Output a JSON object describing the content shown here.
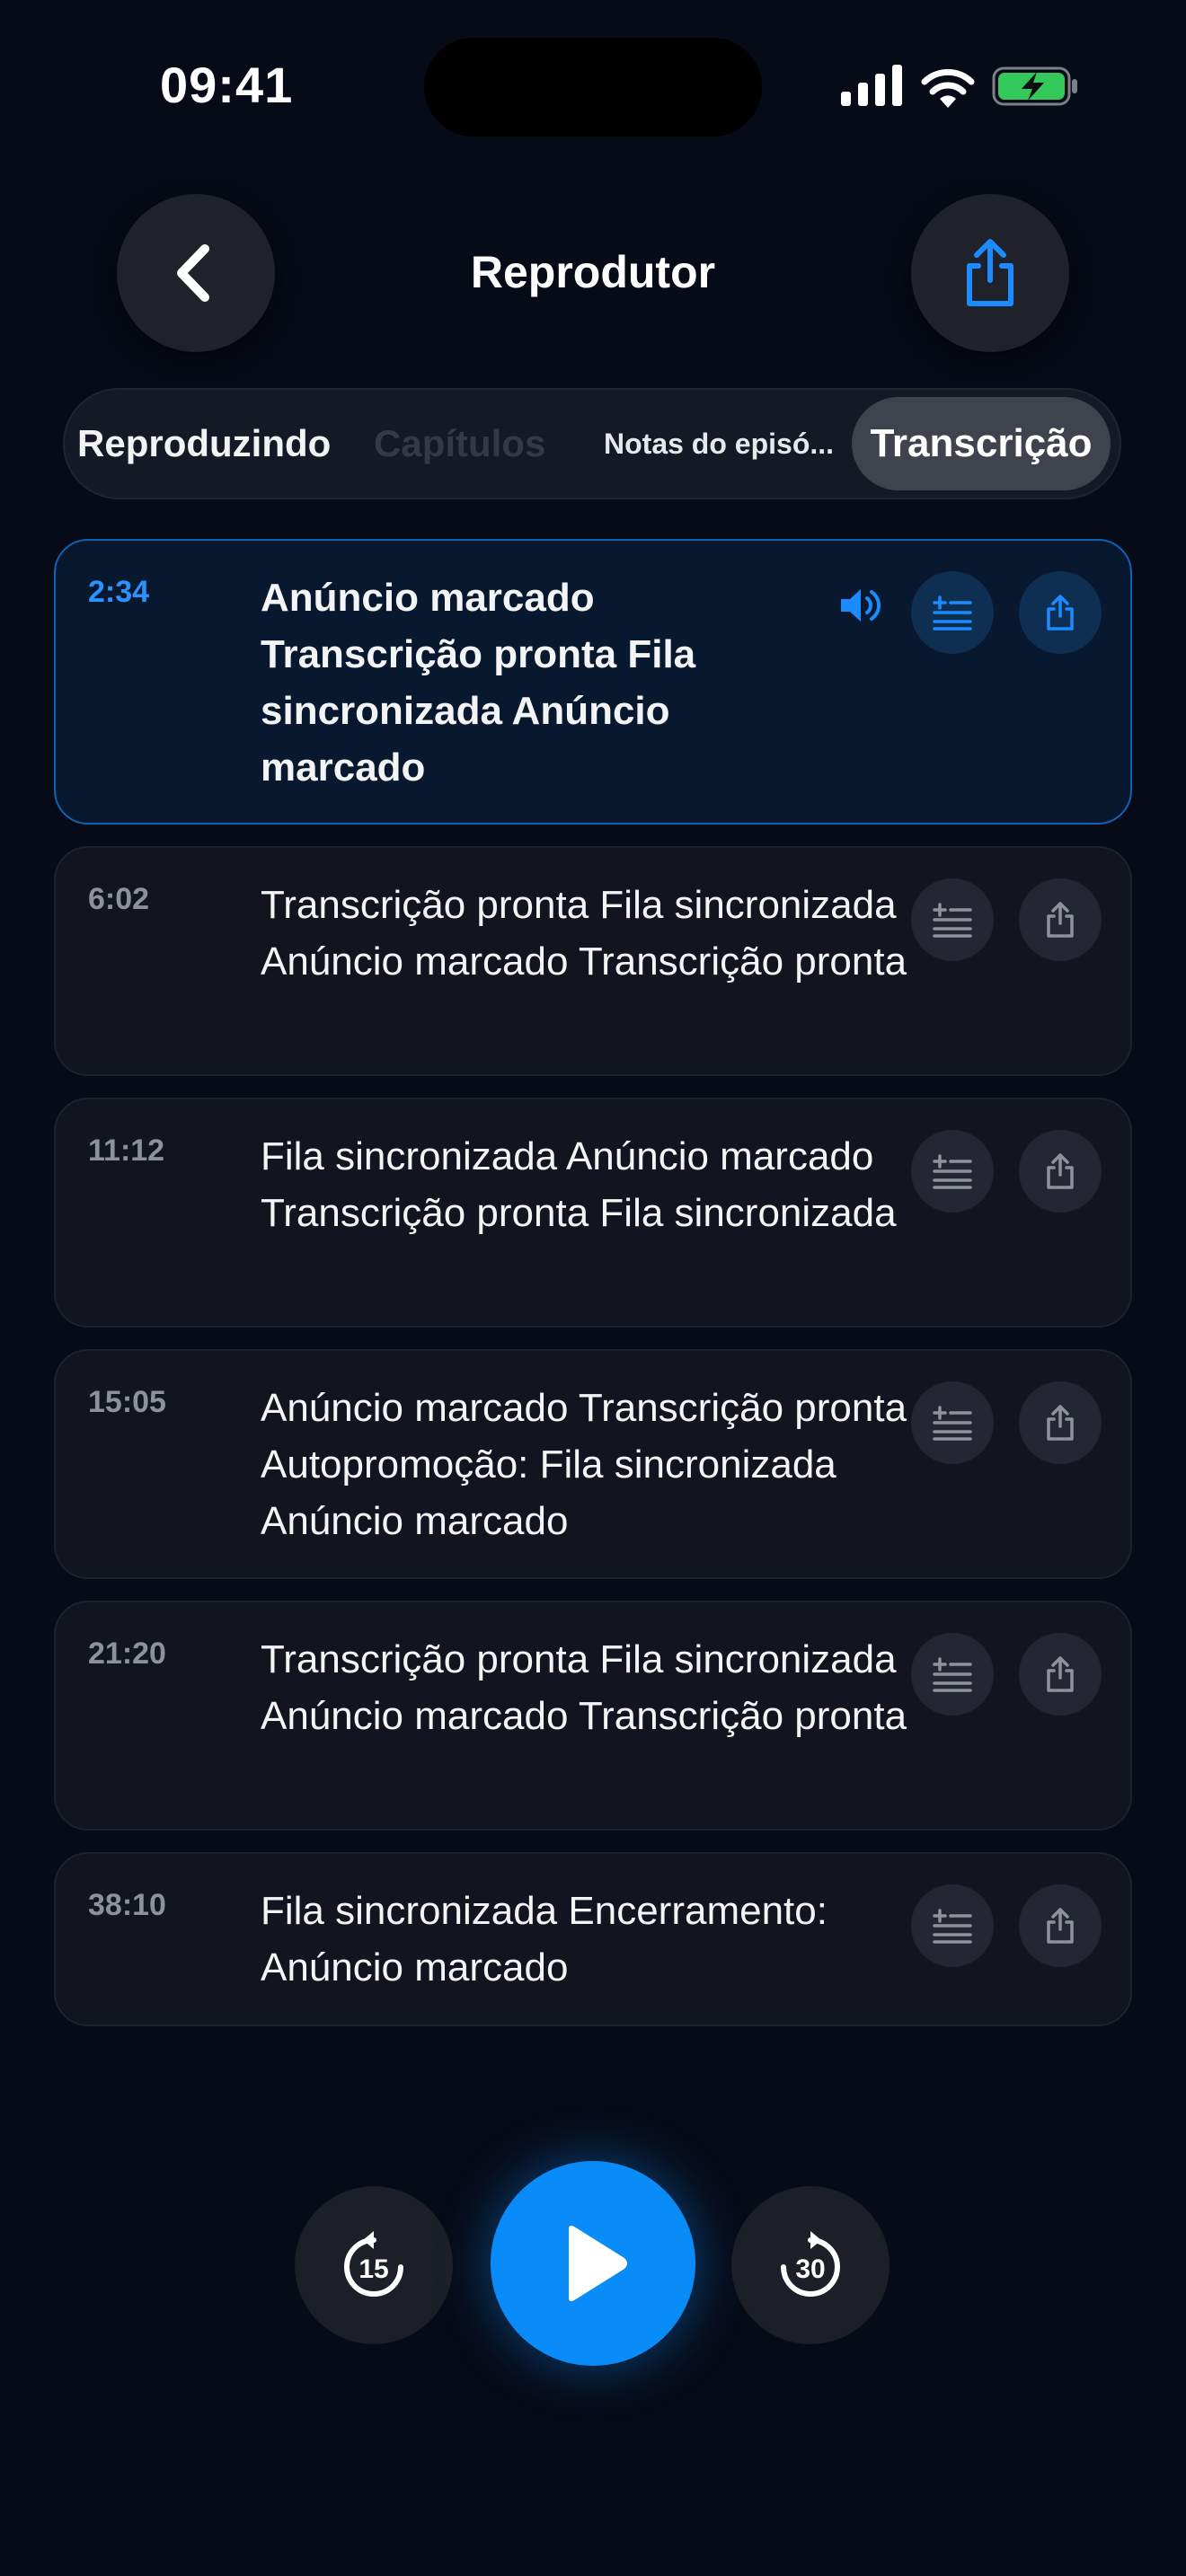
{
  "status_bar": {
    "time": "09:41",
    "icons": [
      "cellular-signal-icon",
      "wifi-icon",
      "battery-charging-icon"
    ]
  },
  "nav": {
    "title": "Reprodutor",
    "back_icon": "chevron-left-icon",
    "share_icon": "share-icon"
  },
  "segments": [
    {
      "label": "Reproduzindo",
      "state": "normal"
    },
    {
      "label": "Capítulos",
      "state": "disabled"
    },
    {
      "label": "Notas do episó...",
      "state": "normal"
    },
    {
      "label": "Transcrição",
      "state": "selected"
    }
  ],
  "transcript": [
    {
      "time": "2:34",
      "text": "Anúncio marcado Transcrição pronta Fila sincronizada Anúncio marcado",
      "playing": true
    },
    {
      "time": "6:02",
      "text": "Transcrição pronta Fila sincronizada Anúncio marcado Transcrição pronta",
      "playing": false
    },
    {
      "time": "11:12",
      "text": "Fila sincronizada Anúncio marcado Transcrição pronta Fila sincronizada",
      "playing": false
    },
    {
      "time": "15:05",
      "text": "Anúncio marcado Transcrição pronta Autopromoção: Fila sincronizada Anúncio marcado",
      "playing": false
    },
    {
      "time": "21:20",
      "text": "Transcrição pronta Fila sincronizada Anúncio marcado Transcrição pronta",
      "playing": false
    },
    {
      "time": "38:10",
      "text": "Fila sincronizada Encerramento: Anúncio marcado",
      "playing": false
    }
  ],
  "player": {
    "skip_back_seconds": "15",
    "skip_forward_seconds": "30",
    "play_icon": "play-icon"
  },
  "colors": {
    "accent": "#0a8cf8",
    "background": "#070b17",
    "card": "#12151f",
    "active_card": "#08182e",
    "active_border": "#1161b6"
  }
}
